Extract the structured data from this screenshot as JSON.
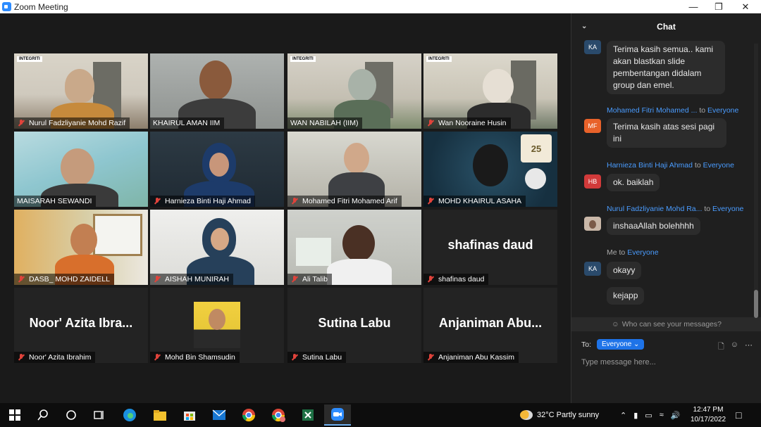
{
  "window": {
    "title": "Zoom Meeting",
    "controls": {
      "minimize": "—",
      "maximize": "❐",
      "close": "✕"
    }
  },
  "gallery": {
    "participants": [
      {
        "name": "Nurul Fadzliyanie Mohd Razif",
        "video": true,
        "logo_label": "INTEGRITI"
      },
      {
        "name": "KHAIRUL AMAN IIM",
        "video": true,
        "active_speaker": true
      },
      {
        "name": "WAN NABILAH (IIM)",
        "video": true,
        "logo_label": "INTEGRITI"
      },
      {
        "name": "Wan Nooraine Husin",
        "video": true,
        "logo_label": "INTEGRITI"
      },
      {
        "name": "MAISARAH SEWANDI",
        "video": true
      },
      {
        "name": "Harnieza Binti Haji Ahmad",
        "video": true
      },
      {
        "name": "Mohamed Fitri Mohamed Arif",
        "video": true
      },
      {
        "name": "MOHD KHAIRUL ASAHA",
        "video": true,
        "badge_text": "25"
      },
      {
        "name": "DASB_ MOHD ZAIDELL",
        "video": true
      },
      {
        "name": "AISHAH MUNIRAH",
        "video": true
      },
      {
        "name": "Ali Talib",
        "video": true
      },
      {
        "name": "shafinas daud",
        "display_name": "shafinas daud",
        "video": false
      },
      {
        "name": "Noor' Azita Ibrahim",
        "display_name": "Noor' Azita Ibra...",
        "video": false
      },
      {
        "name": "Mohd Bin Shamsudin",
        "video": false,
        "photo": true
      },
      {
        "name": "Sutina Labu",
        "display_name": "Sutina Labu",
        "video": false
      },
      {
        "name": "Anjaniman Abu Kassim",
        "display_name": "Anjaniman Abu...",
        "video": false
      }
    ]
  },
  "chat": {
    "title": "Chat",
    "messages": [
      {
        "avatar": "KA",
        "avatar_color": "#2a4a6b",
        "sender": "",
        "to": "",
        "lines": [
          "Terima kasih semua.. kami",
          "akan blastkan slide",
          "pembentangan didalam",
          "group dan emel."
        ]
      },
      {
        "avatar": "MF",
        "avatar_color": "#e8622a",
        "sender": "Mohamed Fitri Mohamed ...",
        "to": "to",
        "to_target": "Everyone",
        "lines": [
          "Terima kasih atas sesi pagi",
          "ini"
        ]
      },
      {
        "avatar": "HB",
        "avatar_color": "#d13a3a",
        "sender": "Harnieza Binti Haji Ahmad",
        "to": "to",
        "to_target": "Everyone",
        "lines": [
          "ok. baiklah"
        ]
      },
      {
        "avatar": "",
        "avatar_color": "#c9b7a8",
        "sender": "Nurul Fadzliyanie Mohd Ra...",
        "to": "to",
        "to_target": "Everyone",
        "lines": [
          "inshaaAllah bolehhhh"
        ]
      },
      {
        "avatar": "KA",
        "avatar_color": "#2a4a6b",
        "sender": "Me",
        "to": "to",
        "to_target": "Everyone",
        "lines": [
          "okayy"
        ]
      },
      {
        "avatar": "",
        "avatar_color": "",
        "sender": "",
        "to": "",
        "lines": [
          "kejapp"
        ]
      }
    ],
    "who_can_see": "Who can see your messages?",
    "to_label": "To:",
    "to_select": "Everyone",
    "input_placeholder": "Type message here..."
  },
  "taskbar": {
    "weather": "32°C  Partly sunny",
    "time": "12:47 PM",
    "date": "10/17/2022",
    "accent": "#6fb0f0"
  }
}
